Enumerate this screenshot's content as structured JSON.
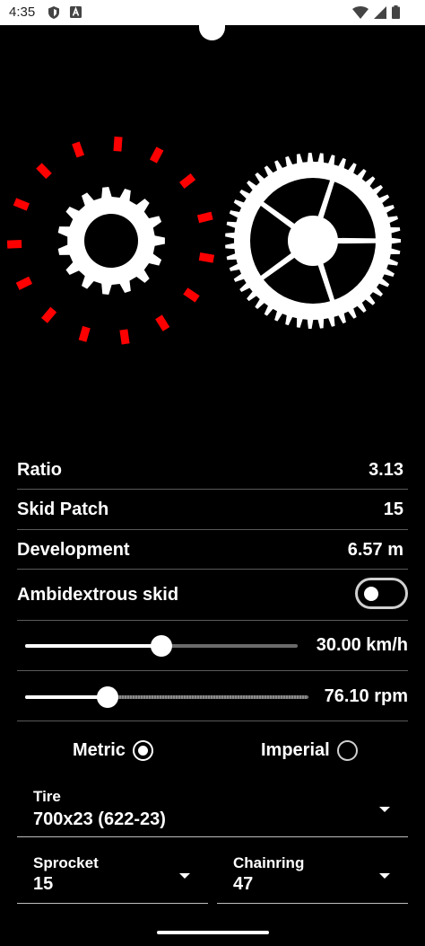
{
  "status_bar": {
    "time": "4:35"
  },
  "stats": {
    "ratio_label": "Ratio",
    "ratio_value": "3.13",
    "skid_patch_label": "Skid Patch",
    "skid_patch_value": "15",
    "development_label": "Development",
    "development_value": "6.57 m"
  },
  "ambidextrous": {
    "label": "Ambidextrous skid",
    "enabled": false
  },
  "speed_slider": {
    "value_text": "30.00 km/h",
    "fraction": 0.5
  },
  "cadence_slider": {
    "value_text": "76.10 rpm",
    "fraction": 0.29
  },
  "units": {
    "metric_label": "Metric",
    "imperial_label": "Imperial",
    "selected": "Metric"
  },
  "tire": {
    "label": "Tire",
    "value": "700x23 (622-23)"
  },
  "sprocket": {
    "label": "Sprocket",
    "value": "15"
  },
  "chainring": {
    "label": "Chainring",
    "value": "47"
  },
  "colors": {
    "skid_marks": "#ff0000",
    "background": "#000000",
    "foreground": "#ffffff"
  }
}
